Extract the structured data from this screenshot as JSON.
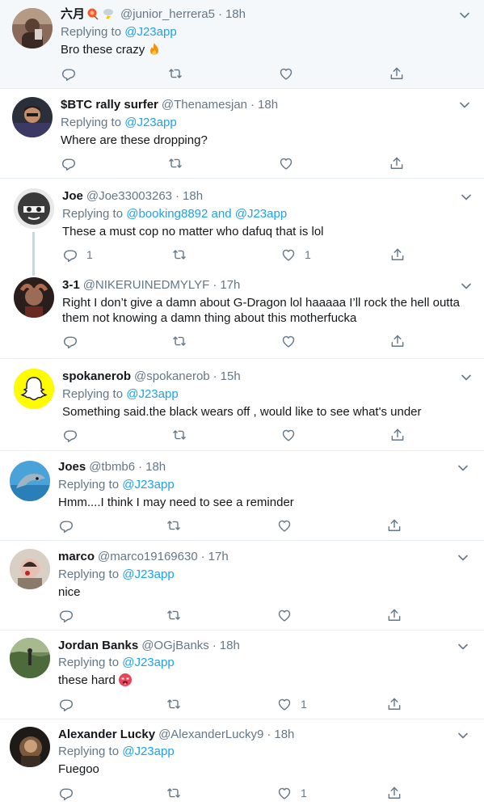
{
  "tweets": [
    {
      "name": "六月",
      "handle": "@junior_herrera5",
      "time": "18h",
      "replying_prefix": "Replying to",
      "replying_to": "@J23app",
      "text": "Bro these crazy",
      "reply_count": "",
      "like_count": ""
    },
    {
      "name": "$BTC rally surfer",
      "handle": "@Thenamesjan",
      "time": "18h",
      "replying_prefix": "Replying to",
      "replying_to": "@J23app",
      "text": "Where are these dropping?",
      "reply_count": "",
      "like_count": ""
    },
    {
      "name": "Joe",
      "handle": "@Joe33003263",
      "time": "18h",
      "replying_prefix": "Replying to",
      "replying_to": "@booking8892 and @J23app",
      "text": "These a must cop no matter who dafuq that is lol",
      "reply_count": "1",
      "like_count": "1"
    },
    {
      "name": "3-1",
      "handle": "@NIKERUINEDMYLYF",
      "time": "17h",
      "text": "Right I don’t give a damn about G-Dragon lol haaaaa I’ll rock the hell outta them not knowing a damn thing about this motherfucka",
      "reply_count": "",
      "like_count": ""
    },
    {
      "name": "spokanerob",
      "handle": "@spokanerob",
      "time": "15h",
      "replying_prefix": "Replying to",
      "replying_to": "@J23app",
      "text": "Something said.the black wears off , would like to see what's under",
      "reply_count": "",
      "like_count": ""
    },
    {
      "name": "Joes",
      "handle": "@tbmb6",
      "time": "18h",
      "replying_prefix": "Replying to",
      "replying_to": "@J23app",
      "text": "Hmm....I think I may need to see a reminder",
      "reply_count": "",
      "like_count": ""
    },
    {
      "name": "marco",
      "handle": "@marco19169630",
      "time": "17h",
      "replying_prefix": "Replying to",
      "replying_to": "@J23app",
      "text": "nice",
      "reply_count": "",
      "like_count": ""
    },
    {
      "name": "Jordan Banks",
      "handle": "@OGjBanks",
      "time": "18h",
      "replying_prefix": "Replying to",
      "replying_to": "@J23app",
      "text": "these hard",
      "reply_count": "",
      "like_count": "1"
    },
    {
      "name": "Alexander Lucky",
      "handle": "@AlexanderLucky9",
      "time": "18h",
      "replying_prefix": "Replying to",
      "replying_to": "@J23app",
      "text": "Fuegoo",
      "reply_count": "",
      "like_count": "1"
    }
  ],
  "icons": {
    "reply": "reply-icon",
    "retweet": "retweet-icon",
    "like": "heart-icon",
    "share": "share-icon",
    "caret": "chevron-down-icon",
    "fire": "fire-emoji",
    "hot_face": "hot-face-emoji"
  },
  "colors": {
    "link": "#1da1f2",
    "muted": "#657786",
    "text": "#14171a",
    "highlight_bg": "#f5f8fa"
  }
}
